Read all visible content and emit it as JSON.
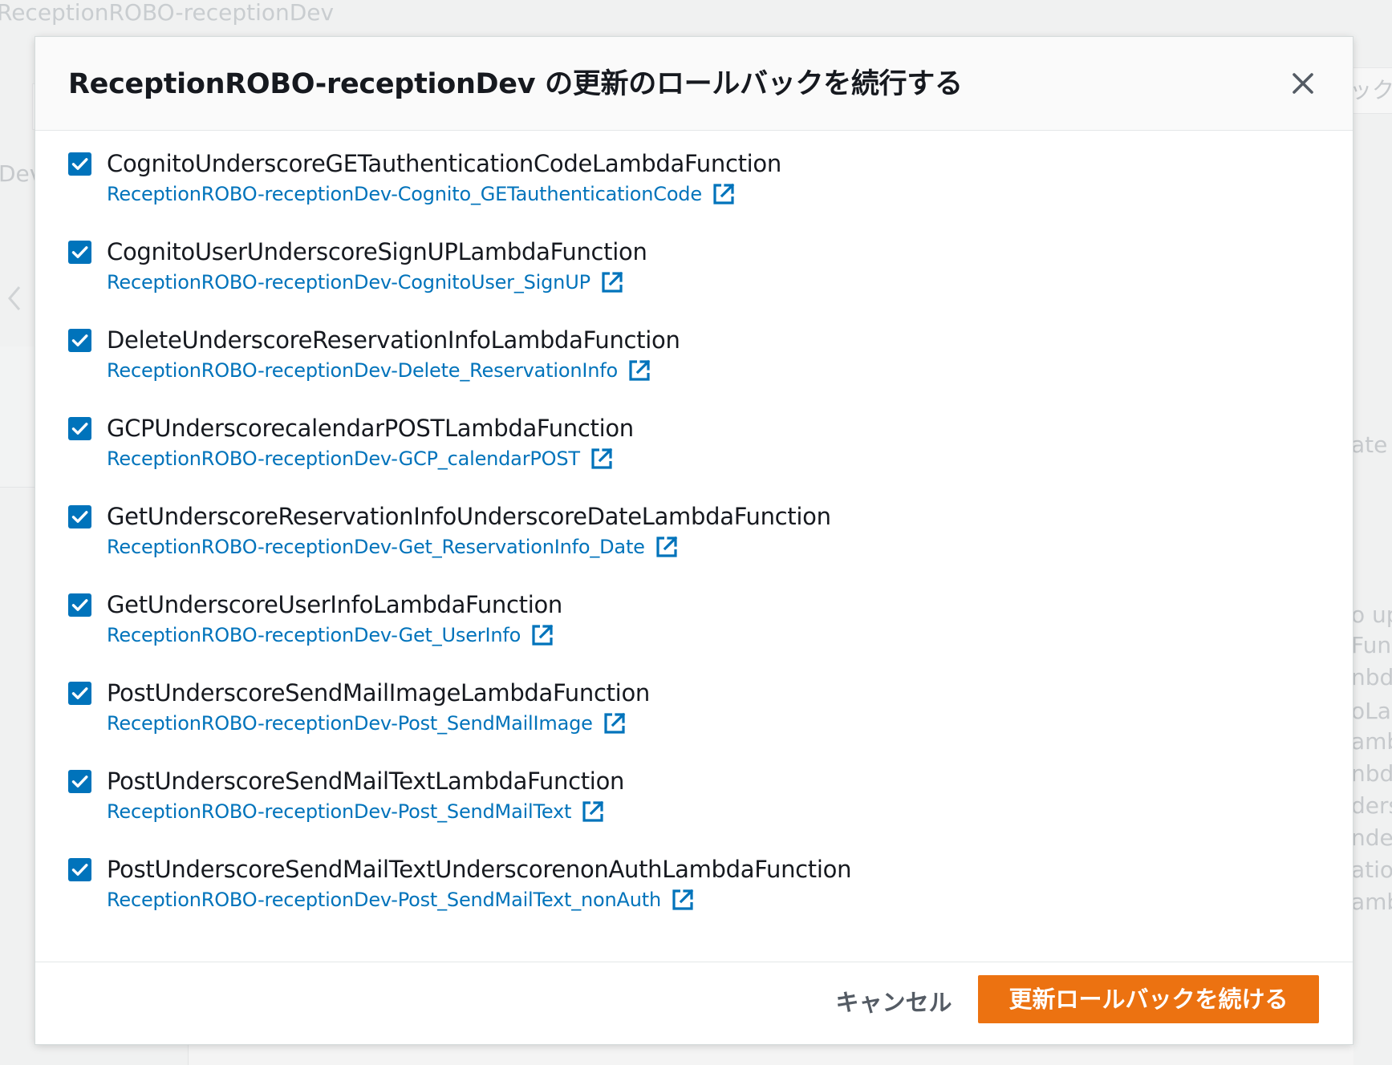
{
  "background": {
    "page_title": "ReceptionROBO-receptionDev",
    "fragments": [
      "Dev",
      "ック",
      "ate f",
      "o up",
      "Func",
      "nbd",
      "oLar",
      "amb",
      "nbda",
      "ders",
      "nder",
      "atio",
      "amb"
    ]
  },
  "modal": {
    "title": "ReceptionROBO-receptionDev の更新のロールバックを続行する",
    "close_icon": "close-icon",
    "resources": [
      {
        "name": "CognitoUnderscoreGETauthenticationCodeLambdaFunction",
        "link": "ReceptionROBO-receptionDev-Cognito_GETauthenticationCode",
        "checked": true
      },
      {
        "name": "CognitoUserUnderscoreSignUPLambdaFunction",
        "link": "ReceptionROBO-receptionDev-CognitoUser_SignUP",
        "checked": true
      },
      {
        "name": "DeleteUnderscoreReservationInfoLambdaFunction",
        "link": "ReceptionROBO-receptionDev-Delete_ReservationInfo",
        "checked": true
      },
      {
        "name": "GCPUnderscorecalendarPOSTLambdaFunction",
        "link": "ReceptionROBO-receptionDev-GCP_calendarPOST",
        "checked": true
      },
      {
        "name": "GetUnderscoreReservationInfoUnderscoreDateLambdaFunction",
        "link": "ReceptionROBO-receptionDev-Get_ReservationInfo_Date",
        "checked": true
      },
      {
        "name": "GetUnderscoreUserInfoLambdaFunction",
        "link": "ReceptionROBO-receptionDev-Get_UserInfo",
        "checked": true
      },
      {
        "name": "PostUnderscoreSendMailImageLambdaFunction",
        "link": "ReceptionROBO-receptionDev-Post_SendMailImage",
        "checked": true
      },
      {
        "name": "PostUnderscoreSendMailTextLambdaFunction",
        "link": "ReceptionROBO-receptionDev-Post_SendMailText",
        "checked": true
      },
      {
        "name": "PostUnderscoreSendMailTextUnderscorenonAuthLambdaFunction",
        "link": "ReceptionROBO-receptionDev-Post_SendMailText_nonAuth",
        "checked": true
      }
    ],
    "footer": {
      "cancel_label": "キャンセル",
      "continue_label": "更新ロールバックを続ける"
    }
  },
  "colors": {
    "accent_orange": "#ec7211",
    "link_blue": "#0073bb",
    "checkbox_blue": "#0073bb"
  }
}
